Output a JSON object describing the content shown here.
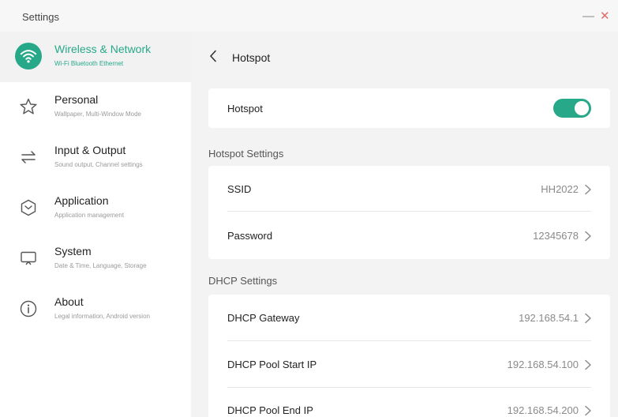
{
  "window": {
    "title": "Settings",
    "minimize_glyph": "—",
    "close_glyph": "✕"
  },
  "sidebar": {
    "items": [
      {
        "title": "Wireless & Network",
        "subtitle": "Wi-Fi Bluetooth Ethernet",
        "icon": "wifi-icon",
        "active": true
      },
      {
        "title": "Personal",
        "subtitle": "Wallpaper, Multi-Window Mode",
        "icon": "star-icon",
        "active": false
      },
      {
        "title": "Input & Output",
        "subtitle": "Sound output, Channel settings",
        "icon": "swap-arrows-icon",
        "active": false
      },
      {
        "title": "Application",
        "subtitle": "Application management",
        "icon": "app-hexagon-icon",
        "active": false
      },
      {
        "title": "System",
        "subtitle": "Date & Time, Language, Storage",
        "icon": "monitor-icon",
        "active": false
      },
      {
        "title": "About",
        "subtitle": "Legal information, Android version",
        "icon": "info-icon",
        "active": false
      }
    ]
  },
  "main": {
    "title": "Hotspot",
    "hotspot_toggle": {
      "label": "Hotspot",
      "on": true
    },
    "hotspot_settings": {
      "header": "Hotspot Settings",
      "ssid": {
        "label": "SSID",
        "value": "HH2022"
      },
      "password": {
        "label": "Password",
        "value": "12345678"
      }
    },
    "dhcp_settings": {
      "header": "DHCP Settings",
      "gateway": {
        "label": "DHCP Gateway",
        "value": "192.168.54.1"
      },
      "pool_start": {
        "label": "DHCP Pool Start IP",
        "value": "192.168.54.100"
      },
      "pool_end": {
        "label": "DHCP Pool End IP",
        "value": "192.168.54.200"
      }
    }
  },
  "colors": {
    "accent": "#27a889",
    "sidebar_active_bg": "#f2f2f2",
    "main_bg": "#f3f3f3",
    "close": "#e06a6a"
  }
}
